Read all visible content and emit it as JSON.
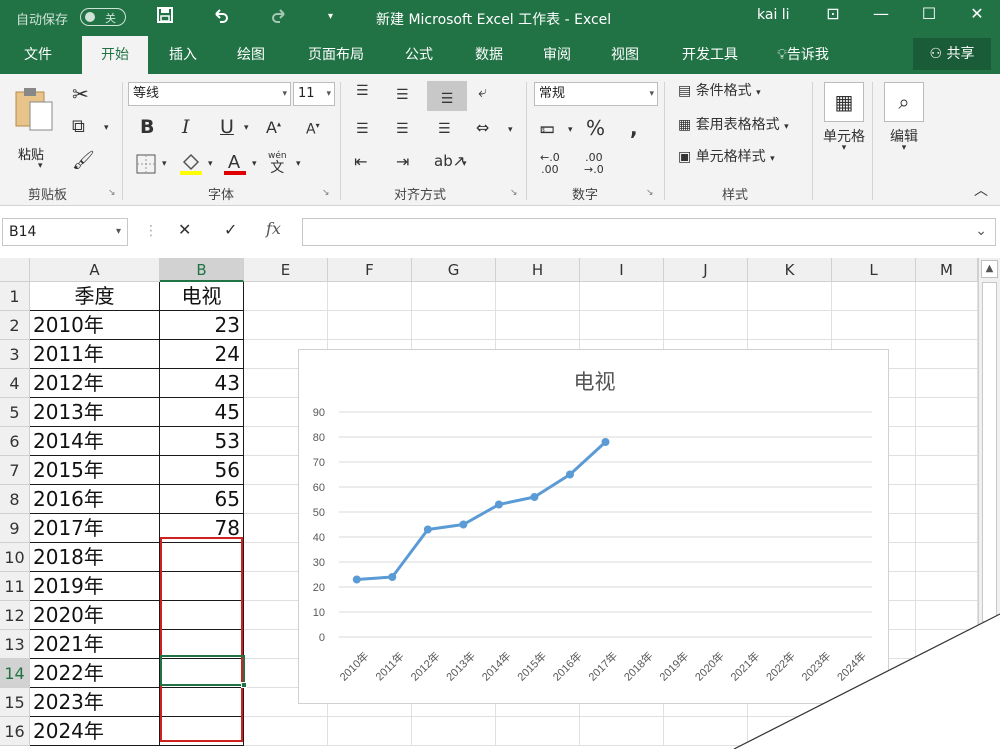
{
  "titlebar": {
    "autosave_label": "自动保存",
    "autosave_state": "关",
    "title": "新建 Microsoft Excel 工作表 - Excel",
    "user": "kai li"
  },
  "tabs": [
    "文件",
    "开始",
    "插入",
    "绘图",
    "页面布局",
    "公式",
    "数据",
    "审阅",
    "视图",
    "开发工具"
  ],
  "active_tab": "开始",
  "tell_me": "告诉我",
  "share": "共享",
  "ribbon": {
    "clipboard": {
      "paste": "粘贴",
      "label": "剪贴板"
    },
    "font": {
      "name": "等线",
      "size": "11",
      "label": "字体",
      "wen": "wén",
      "wenchar": "文"
    },
    "alignment": {
      "label": "对齐方式"
    },
    "number": {
      "format": "常规",
      "label": "数字",
      "inc": ".0\n.00",
      "dec": ".00\n→.0"
    },
    "styles": {
      "conditional": "条件格式",
      "table": "套用表格格式",
      "cell_styles": "单元格样式",
      "label": "样式"
    },
    "cells": {
      "label": "单元格"
    },
    "editing": {
      "label": "编辑"
    }
  },
  "formula_bar": {
    "name_box": "B14",
    "fx": "fx",
    "value": ""
  },
  "grid": {
    "columns": [
      "A",
      "B",
      "E",
      "F",
      "G",
      "H",
      "I",
      "J",
      "K",
      "L",
      "M"
    ],
    "selected_column": "B",
    "rows": [
      "1",
      "2",
      "3",
      "4",
      "5",
      "6",
      "7",
      "8",
      "9",
      "10",
      "11",
      "12",
      "13",
      "14",
      "15",
      "16"
    ],
    "selected_row": "14",
    "header": {
      "a": "季度",
      "b": "电视"
    },
    "data": [
      {
        "a": "2010年",
        "b": "23"
      },
      {
        "a": "2011年",
        "b": "24"
      },
      {
        "a": "2012年",
        "b": "43"
      },
      {
        "a": "2013年",
        "b": "45"
      },
      {
        "a": "2014年",
        "b": "53"
      },
      {
        "a": "2015年",
        "b": "56"
      },
      {
        "a": "2016年",
        "b": "65"
      },
      {
        "a": "2017年",
        "b": "78"
      },
      {
        "a": "2018年",
        "b": ""
      },
      {
        "a": "2019年",
        "b": ""
      },
      {
        "a": "2020年",
        "b": ""
      },
      {
        "a": "2021年",
        "b": ""
      },
      {
        "a": "2022年",
        "b": ""
      },
      {
        "a": "2023年",
        "b": ""
      },
      {
        "a": "2024年",
        "b": ""
      }
    ]
  },
  "chart_data": {
    "type": "line",
    "title": "电视",
    "categories": [
      "2010年",
      "2011年",
      "2012年",
      "2013年",
      "2014年",
      "2015年",
      "2016年",
      "2017年",
      "2018年",
      "2019年",
      "2020年",
      "2021年",
      "2022年",
      "2023年",
      "2024年"
    ],
    "series": [
      {
        "name": "电视",
        "values": [
          23,
          24,
          43,
          45,
          53,
          56,
          65,
          78,
          null,
          null,
          null,
          null,
          null,
          null,
          null
        ]
      }
    ],
    "ylim": [
      0,
      90
    ],
    "yticks": [
      0,
      10,
      20,
      30,
      40,
      50,
      60,
      70,
      80,
      90
    ],
    "grid": true,
    "legend": "none",
    "line_color": "#5b9bd5"
  },
  "colors": {
    "accent": "#217346",
    "selection_box": "#d02020",
    "series": "#5b9bd5"
  }
}
